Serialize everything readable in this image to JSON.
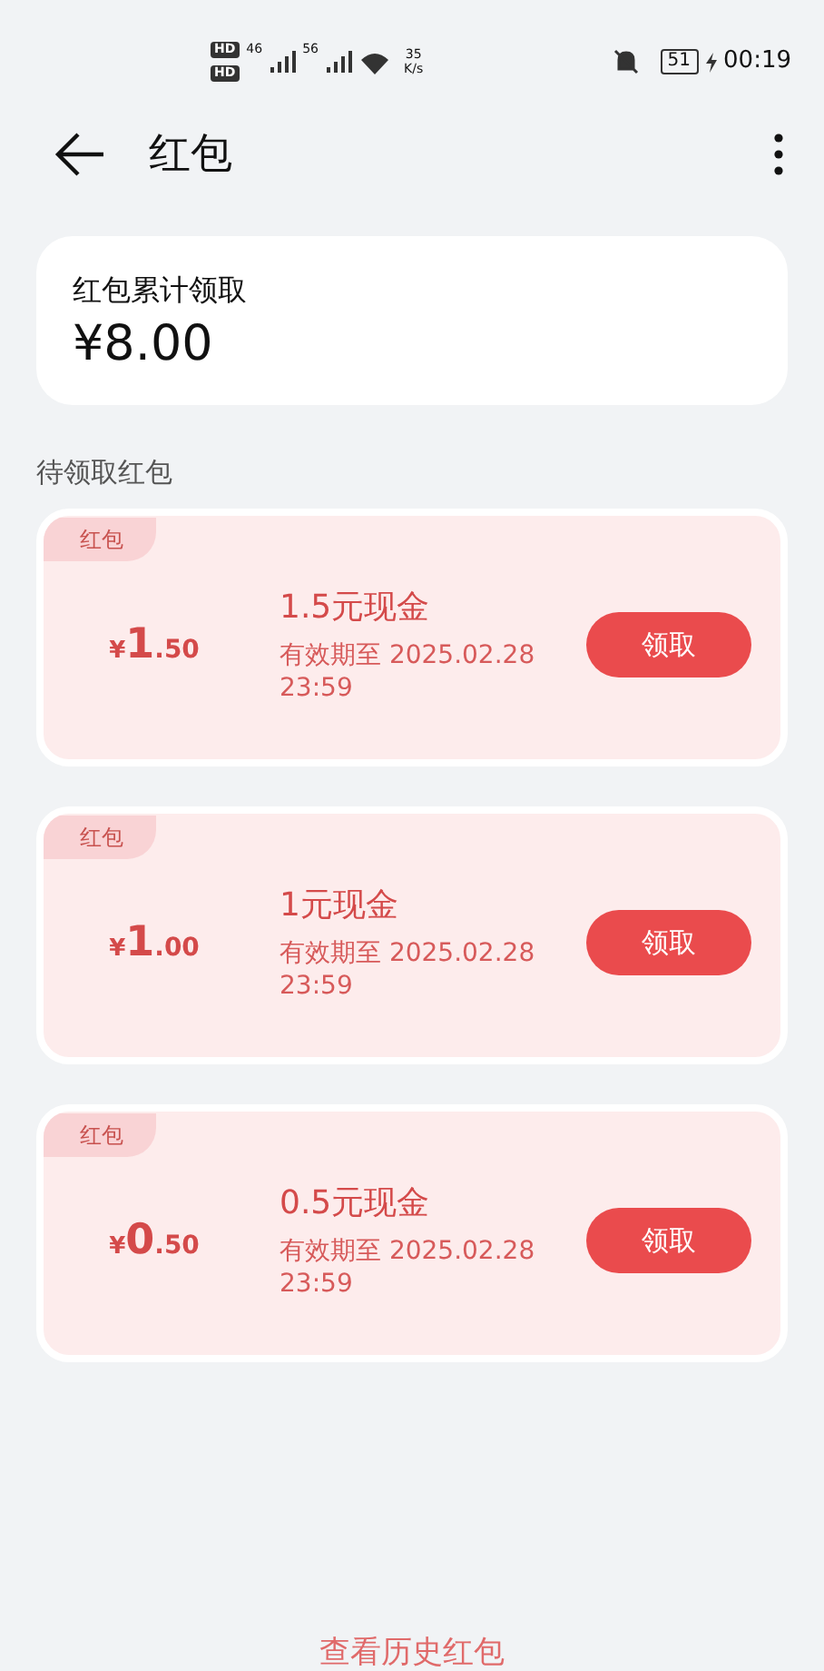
{
  "status_bar": {
    "network_labels": [
      "HD",
      "HD"
    ],
    "signal_labels": [
      "46",
      "56"
    ],
    "speed": "35",
    "speed_unit": "K/s",
    "battery": "51",
    "time": "00:19"
  },
  "header": {
    "title": "红包"
  },
  "summary": {
    "label": "红包累计领取",
    "amount": "¥8.00"
  },
  "section_title": "待领取红包",
  "coupons": [
    {
      "tag": "红包",
      "symbol": "¥",
      "integer": "1",
      "decimal": ".50",
      "name": "1.5元现金",
      "expiry": "有效期至 2025.02.28 23:59",
      "button": "领取"
    },
    {
      "tag": "红包",
      "symbol": "¥",
      "integer": "1",
      "decimal": ".00",
      "name": "1元现金",
      "expiry": "有效期至 2025.02.28 23:59",
      "button": "领取"
    },
    {
      "tag": "红包",
      "symbol": "¥",
      "integer": "0",
      "decimal": ".50",
      "name": "0.5元现金",
      "expiry": "有效期至 2025.02.28 23:59",
      "button": "领取"
    }
  ],
  "footer_link": "查看历史红包"
}
